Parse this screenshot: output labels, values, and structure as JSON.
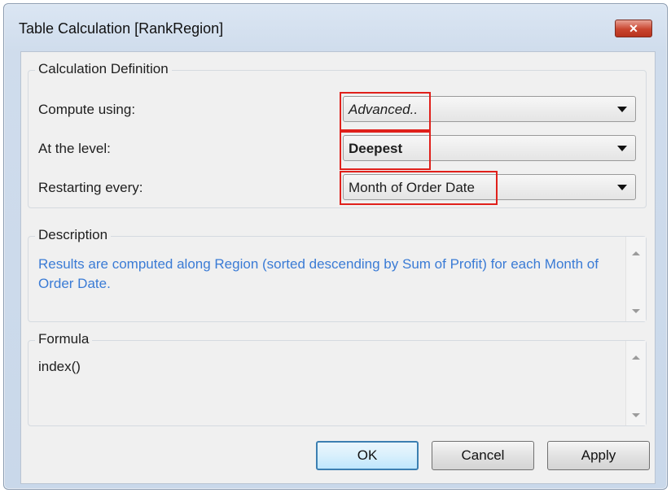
{
  "window": {
    "title": "Table Calculation [RankRegion]",
    "close_icon": "close-icon"
  },
  "calculation_definition": {
    "label": "Calculation Definition",
    "compute_using": {
      "label": "Compute using:",
      "value": "Advanced.."
    },
    "at_the_level": {
      "label": "At the level:",
      "value": "Deepest"
    },
    "restarting_every": {
      "label": "Restarting every:",
      "value": "Month of Order Date"
    }
  },
  "description": {
    "label": "Description",
    "text": "Results are computed along Region (sorted descending by Sum of Profit) for each Month of Order Date."
  },
  "formula": {
    "label": "Formula",
    "text": "index()"
  },
  "buttons": {
    "ok": "OK",
    "cancel": "Cancel",
    "apply": "Apply"
  },
  "colors": {
    "highlight": "#e0201b",
    "description_text": "#3a7bd5",
    "close_button": "#c9452f"
  }
}
